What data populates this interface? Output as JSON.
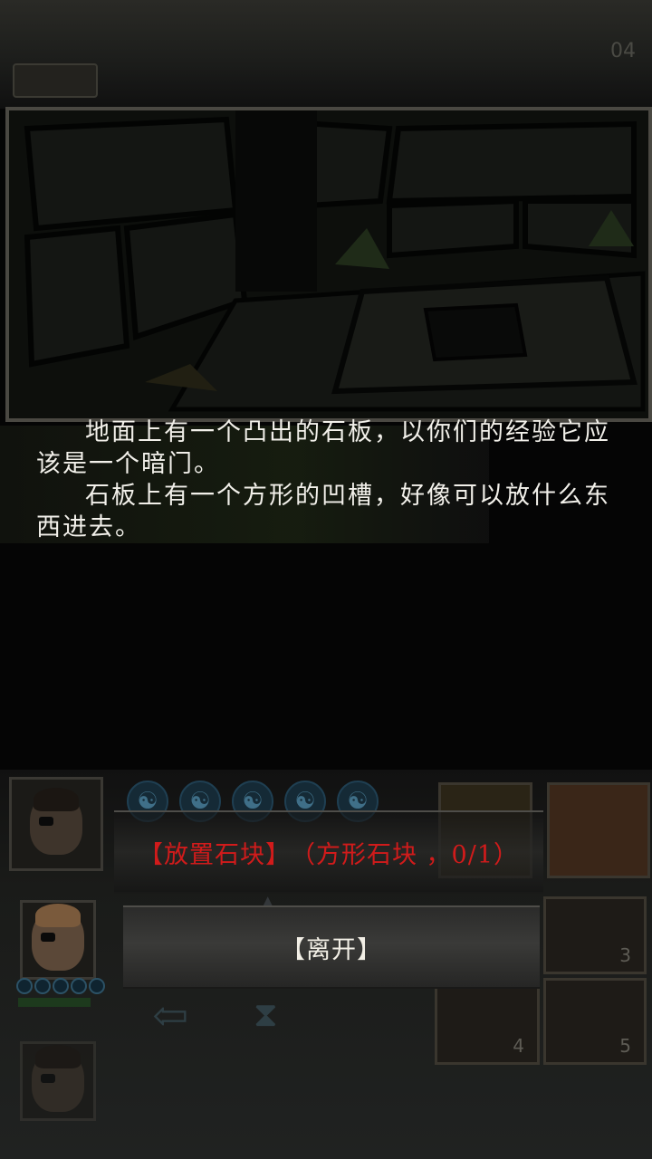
{
  "hud": {
    "score": "04",
    "slot_counts": [
      "3",
      "4",
      "5"
    ]
  },
  "event": {
    "paragraphs": [
      "地面上有一个凸出的石板，以你们的经验它应该是一个暗门。",
      "石板上有一个方形的凹槽，好像可以放什么东西进去。"
    ]
  },
  "choices": {
    "place_action": "【放置石块】",
    "place_requirement": "（方形石块 ，0/1）",
    "leave": "【离开】"
  },
  "colors": {
    "requirement_text": "#d11b1b",
    "body_text": "#f2f0ea",
    "background": "#050505"
  },
  "icons": [
    "mana-icon",
    "arrow-left-icon",
    "hourglass-icon"
  ]
}
